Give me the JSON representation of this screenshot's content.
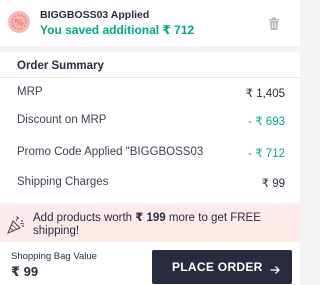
{
  "promo": {
    "code_applied": "BIGGBOSS03 Applied",
    "saved_text": "You saved additional ₹ 712"
  },
  "summary": {
    "title": "Order Summary",
    "rows": [
      {
        "label": "MRP",
        "value": "₹ 1,405"
      },
      {
        "label": "Discount on MRP",
        "value": "- ₹ 693"
      },
      {
        "label": "Promo Code Applied \"BIGGBOSS03",
        "value": "- ₹ 712"
      },
      {
        "label": "Shipping Charges",
        "value": "₹ 99"
      }
    ]
  },
  "free_shipping": {
    "line1_prefix": "Add products worth ",
    "line1_amount": "₹ 199",
    "line1_suffix": " more to get FREE",
    "line2": "shipping!"
  },
  "bag": {
    "label": "Shopping Bag Value",
    "value": "₹ 99"
  },
  "cta": {
    "label": "PLACE ORDER"
  },
  "colors": {
    "accent_green": "#03a685",
    "button_dark": "#282c3f",
    "banner_pink": "#fdebea"
  },
  "icons": [
    "percent-badge-icon",
    "delete-icon",
    "party-popper-icon",
    "arrow-right-icon"
  ]
}
